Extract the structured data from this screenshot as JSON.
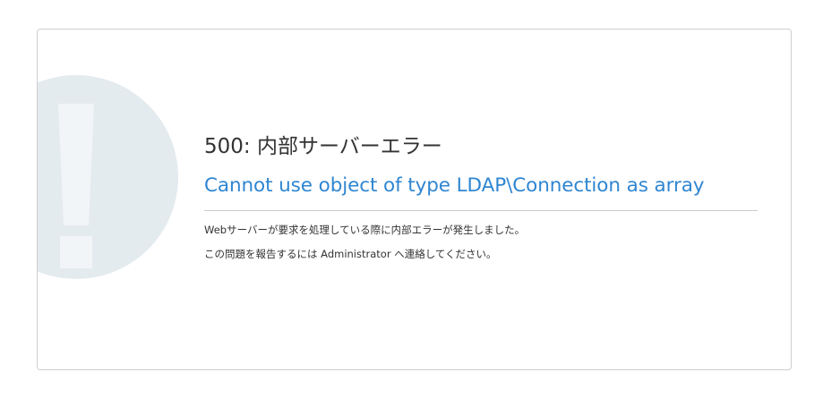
{
  "error": {
    "heading": "500: 内部サーバーエラー",
    "message": "Cannot use object of type LDAP\\Connection as array",
    "description_line1": "Webサーバーが要求を処理している際に内部エラーが発生しました。",
    "description_line2": "この問題を報告するには Administrator へ連絡してください。"
  },
  "colors": {
    "heading": "#333333",
    "message_link": "#2f86d1",
    "icon_background": "#e4ebef",
    "icon_mark": "#f2f5f7",
    "card_border": "#cfcfcf"
  },
  "icons": {
    "error_graphic": "exclamation-circle-icon"
  }
}
